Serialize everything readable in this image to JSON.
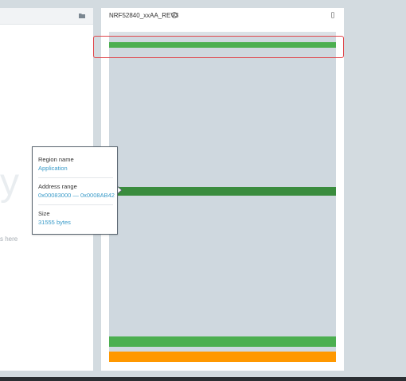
{
  "file_panel": {
    "ghost_glyph": "y",
    "drop_hint": "s here"
  },
  "device": {
    "title": "NRF52840_xxAA_REV3",
    "regions": [
      {
        "color": "#4caf50"
      },
      {
        "color": "#3a8c3e"
      },
      {
        "color": "#4caf50"
      },
      {
        "color": "#ff9800"
      }
    ]
  },
  "tooltip": {
    "region_name_label": "Region name",
    "region_name_value": "Application",
    "address_range_label": "Address range",
    "address_range_value": "0x00083000 — 0x0008AB42",
    "size_label": "Size",
    "size_value": "31555 bytes"
  },
  "colors": {
    "highlight": "#e0474c",
    "link": "#3a9bc9",
    "memory_background": "#cfd8df"
  },
  "icons": [
    "folder-icon",
    "info-icon",
    "device-menu-icon"
  ]
}
